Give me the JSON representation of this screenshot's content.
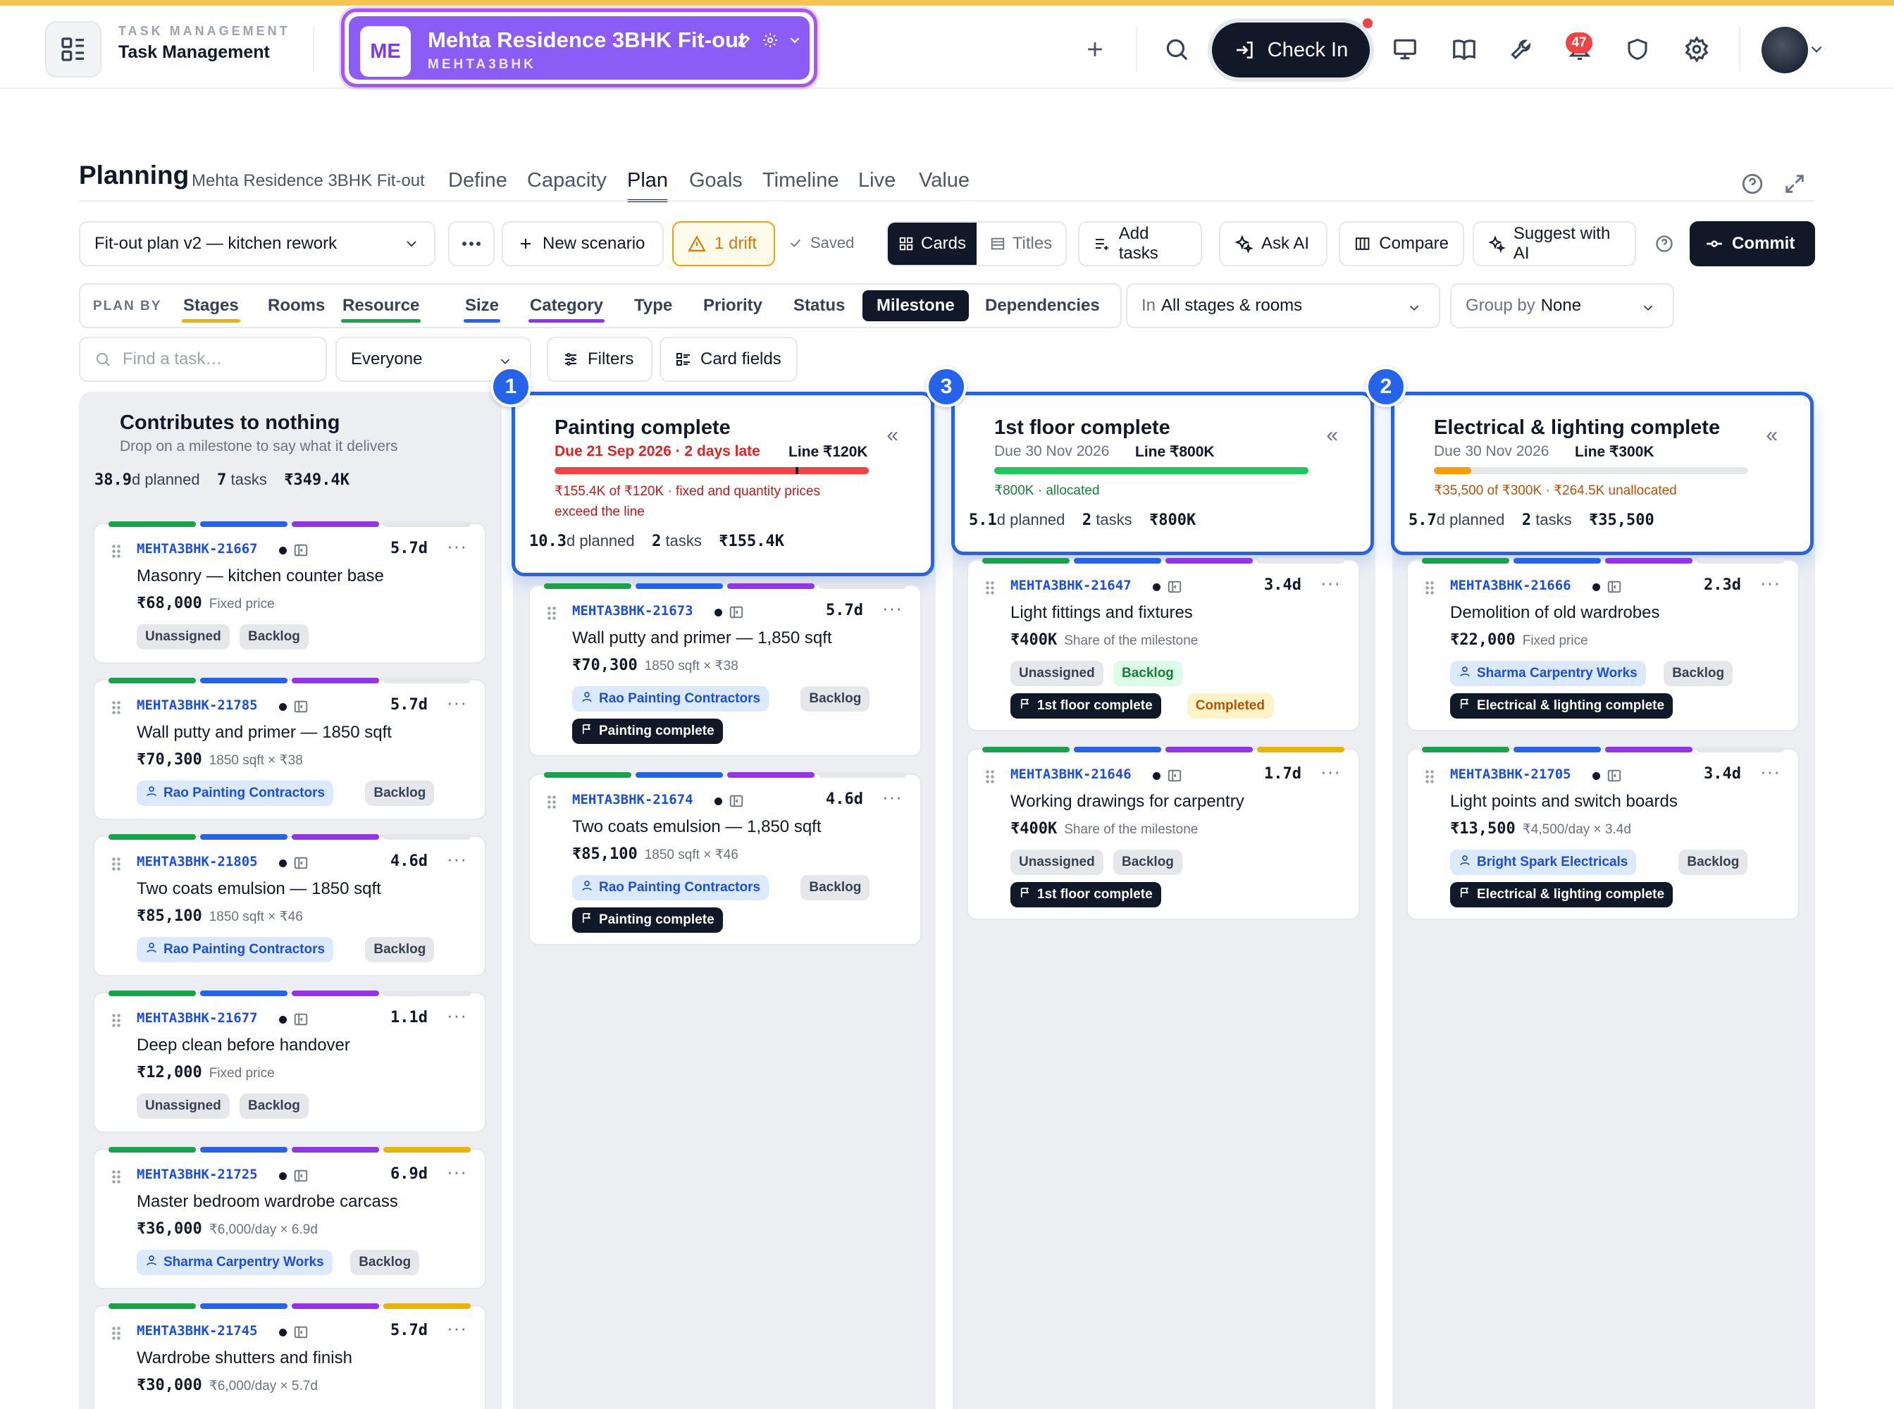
{
  "app": {
    "tag": "TASK MANAGEMENT",
    "name": "Task Management"
  },
  "project": {
    "initials": "ME",
    "name": "Mehta Residence 3BHK Fit-out",
    "code": "MEHTA3BHK"
  },
  "toolbar": {
    "checkin": "Check In",
    "notifications": "47"
  },
  "page": {
    "title": "Planning",
    "subtitle": "Mehta Residence 3BHK Fit-out"
  },
  "tabs": [
    "Define",
    "Capacity",
    "Plan",
    "Goals",
    "Timeline",
    "Live",
    "Value"
  ],
  "controls": {
    "scenario": "Fit-out plan v2 — kitchen rework",
    "new_scenario": "New scenario",
    "drift": "1 drift",
    "saved": "Saved",
    "cards": "Cards",
    "titles": "Titles",
    "add_tasks": "Add tasks",
    "ask_ai": "Ask AI",
    "compare": "Compare",
    "suggest": "Suggest with AI",
    "commit": "Commit"
  },
  "planby": {
    "label": "PLAN BY",
    "items": [
      "Stages",
      "Rooms",
      "Resource",
      "Size",
      "Category",
      "Type",
      "Priority",
      "Status",
      "Milestone",
      "Dependencies"
    ]
  },
  "scope": {
    "prefix": "In",
    "value": "All stages & rooms"
  },
  "group": {
    "prefix": "Group by",
    "value": "None"
  },
  "filters": {
    "search_placeholder": "Find a task…",
    "people": "Everyone",
    "filters": "Filters",
    "card_fields": "Card fields"
  },
  "colors": {
    "accent": "#2563eb",
    "purple": "#8b5cf6",
    "green": "#16a34a",
    "blue": "#2563eb",
    "violet": "#9333ea",
    "yellow": "#eab308",
    "red": "#dc2626"
  },
  "columns": [
    {
      "title": "Contributes to nothing",
      "sub": "Drop on a milestone to say what it delivers",
      "planned_n": "38.9",
      "planned_u": "d planned",
      "tasks_n": "7",
      "tasks_u": "tasks",
      "value": "₹349.4K",
      "cards": [
        {
          "id": "MEHTA3BHK-21667",
          "dur": "5.7d",
          "title": "Masonry — kitchen counter base",
          "price": "₹68,000",
          "price_note": "Fixed price",
          "chips": [
            {
              "t": "Unassigned",
              "k": "gray"
            },
            {
              "t": "Backlog",
              "k": "gray"
            }
          ]
        },
        {
          "id": "MEHTA3BHK-21785",
          "dur": "5.7d",
          "title": "Wall putty and primer — 1850 sqft",
          "price": "₹70,300",
          "price_note": "1850 sqft × ₹38",
          "chips": [
            {
              "t": "Rao Painting Contractors",
              "k": "blue"
            },
            {
              "t": "Backlog",
              "k": "gray"
            }
          ]
        },
        {
          "id": "MEHTA3BHK-21805",
          "dur": "4.6d",
          "title": "Two coats emulsion — 1850 sqft",
          "price": "₹85,100",
          "price_note": "1850 sqft × ₹46",
          "chips": [
            {
              "t": "Rao Painting Contractors",
              "k": "blue"
            },
            {
              "t": "Backlog",
              "k": "gray"
            }
          ]
        },
        {
          "id": "MEHTA3BHK-21677",
          "dur": "1.1d",
          "title": "Deep clean before handover",
          "price": "₹12,000",
          "price_note": "Fixed price",
          "chips": [
            {
              "t": "Unassigned",
              "k": "gray"
            },
            {
              "t": "Backlog",
              "k": "gray"
            }
          ]
        },
        {
          "id": "MEHTA3BHK-21725",
          "dur": "6.9d",
          "title": "Master bedroom wardrobe carcass",
          "price": "₹36,000",
          "price_note": "₹6,000/day × 6.9d",
          "chips": [
            {
              "t": "Sharma Carpentry Works",
              "k": "blue"
            },
            {
              "t": "Backlog",
              "k": "gray"
            }
          ]
        },
        {
          "id": "MEHTA3BHK-21745",
          "dur": "5.7d",
          "title": "Wardrobe shutters and finish",
          "price": "₹30,000",
          "price_note": "₹6,000/day × 5.7d",
          "chips": []
        }
      ]
    },
    {
      "badge": "1",
      "title": "Painting complete",
      "sub": "Due 21 Sep 2026 · 2 days late",
      "line": "Line ₹120K",
      "progress": 1.0,
      "bar_color": "#ef4444",
      "bar_note": "₹155.4K of ₹120K · fixed and quantity prices exceed the line",
      "planned_n": "10.3",
      "planned_u": "d planned",
      "tasks_n": "2",
      "tasks_u": "tasks",
      "value": "₹155.4K",
      "cards": [
        {
          "id": "MEHTA3BHK-21673",
          "dur": "5.7d",
          "title": "Wall putty and primer — 1,850 sqft",
          "price": "₹70,300",
          "price_note": "1850 sqft × ₹38",
          "chips": [
            {
              "t": "Rao Painting Contractors",
              "k": "blue"
            },
            {
              "t": "Backlog",
              "k": "gray"
            }
          ],
          "milestone": "Painting complete"
        },
        {
          "id": "MEHTA3BHK-21674",
          "dur": "4.6d",
          "title": "Two coats emulsion — 1,850 sqft",
          "price": "₹85,100",
          "price_note": "1850 sqft × ₹46",
          "chips": [
            {
              "t": "Rao Painting Contractors",
              "k": "blue"
            },
            {
              "t": "Backlog",
              "k": "gray"
            }
          ],
          "milestone": "Painting complete"
        }
      ]
    },
    {
      "badge": "3",
      "title": "1st floor complete",
      "sub": "Due 30 Nov 2026",
      "line": "Line ₹800K",
      "progress": 1.0,
      "bar_color": "#22c55e",
      "bar_note": "₹800K · allocated",
      "planned_n": "5.1",
      "planned_u": "d planned",
      "tasks_n": "2",
      "tasks_u": "tasks",
      "value": "₹800K",
      "cards": [
        {
          "id": "MEHTA3BHK-21647",
          "dur": "3.4d",
          "title": "Light fittings and fixtures",
          "price": "₹400K",
          "price_note": "Share of the milestone",
          "chips": [
            {
              "t": "Unassigned",
              "k": "gray"
            },
            {
              "t": "Backlog",
              "k": "green"
            }
          ],
          "milestone": "1st floor complete",
          "extra": "Completed"
        },
        {
          "id": "MEHTA3BHK-21646",
          "dur": "1.7d",
          "title": "Working drawings for carpentry",
          "price": "₹400K",
          "price_note": "Share of the milestone",
          "chips": [
            {
              "t": "Unassigned",
              "k": "gray"
            },
            {
              "t": "Backlog",
              "k": "gray"
            }
          ],
          "milestone": "1st floor complete"
        }
      ]
    },
    {
      "badge": "2",
      "title": "Electrical & lighting complete",
      "sub": "Due 30 Nov 2026",
      "line": "Line ₹300K",
      "progress": 0.118,
      "bar_color": "#f59e0b",
      "bar_note": "₹35,500 of ₹300K · ₹264.5K unallocated",
      "planned_n": "5.7",
      "planned_u": "d planned",
      "tasks_n": "2",
      "tasks_u": "tasks",
      "value": "₹35,500",
      "cards": [
        {
          "id": "MEHTA3BHK-21666",
          "dur": "2.3d",
          "title": "Demolition of old wardrobes",
          "price": "₹22,000",
          "price_note": "Fixed price",
          "chips": [
            {
              "t": "Sharma Carpentry Works",
              "k": "blue"
            },
            {
              "t": "Backlog",
              "k": "gray"
            }
          ],
          "milestone": "Electrical & lighting complete"
        },
        {
          "id": "MEHTA3BHK-21705",
          "dur": "3.4d",
          "title": "Light points and switch boards",
          "price": "₹13,500",
          "price_note": "₹4,500/day × 3.4d",
          "chips": [
            {
              "t": "Bright Spark Electricals",
              "k": "blue"
            },
            {
              "t": "Backlog",
              "k": "gray"
            }
          ],
          "milestone": "Electrical & lighting complete"
        }
      ]
    }
  ]
}
